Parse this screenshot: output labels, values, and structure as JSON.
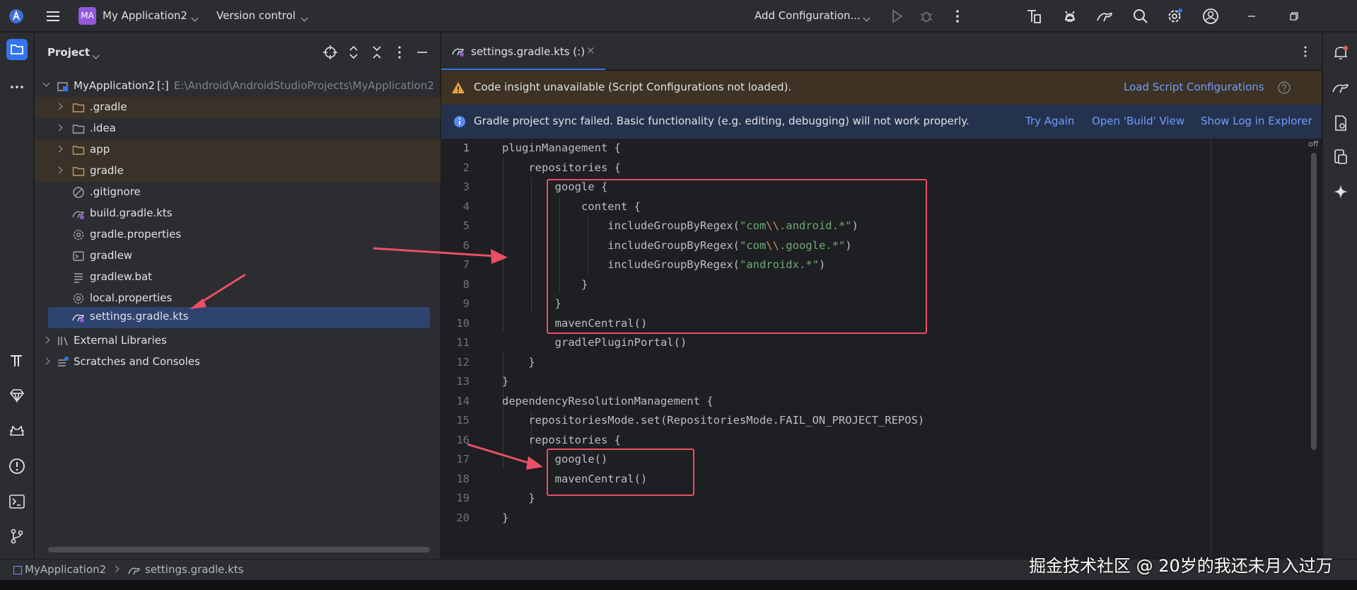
{
  "titlebar": {
    "project_badge": "MA",
    "project_name": "My Application2",
    "vcs_label": "Version control",
    "run_config": "Add Configuration..."
  },
  "project_panel": {
    "title": "Project",
    "tree": [
      {
        "label": ".gradle",
        "icon": "folder-icon"
      },
      {
        "label": ".idea",
        "icon": "folder-icon"
      },
      {
        "label": "app",
        "icon": "folder-icon"
      },
      {
        "label": "gradle",
        "icon": "folder-icon"
      },
      {
        "label": ".gitignore",
        "icon": "ignore-file-icon"
      },
      {
        "label": "build.gradle.kts",
        "icon": "gradle-file-icon"
      },
      {
        "label": "gradle.properties",
        "icon": "settings-file-icon"
      },
      {
        "label": "gradlew",
        "icon": "terminal-file-icon"
      },
      {
        "label": "gradlew.bat",
        "icon": "text-file-icon"
      },
      {
        "label": "local.properties",
        "icon": "settings-file-icon"
      },
      {
        "label": "settings.gradle.kts",
        "icon": "gradle-file-icon"
      }
    ],
    "root_label": "MyApplication2",
    "root_path": "E:\\Android\\AndroidStudioProjects\\MyApplication2",
    "root_module_tag": "[:]",
    "external_libraries": "External Libraries",
    "scratches": "Scratches and Consoles"
  },
  "editor": {
    "tab_label": "settings.gradle.kts (:)",
    "tab_close": "×",
    "warn_banner": {
      "text": "Code insight unavailable (Script Configurations not loaded).",
      "action": "Load Script Configurations"
    },
    "info_banner": {
      "text": "Gradle project sync failed. Basic functionality (e.g. editing, debugging) will not work properly.",
      "actions": [
        "Try Again",
        "Open 'Build' View",
        "Show Log in Explorer"
      ]
    },
    "inspection_label": "off",
    "lines": [
      {
        "n": "1",
        "parts": [
          {
            "t": "pluginManagement {"
          }
        ]
      },
      {
        "n": "2",
        "parts": [
          {
            "t": "    repositories {"
          }
        ]
      },
      {
        "n": "3",
        "parts": [
          {
            "t": "        google {"
          }
        ]
      },
      {
        "n": "4",
        "parts": [
          {
            "t": "            content {"
          }
        ]
      },
      {
        "n": "5",
        "parts": [
          {
            "t": "                includeGroupByRegex("
          },
          {
            "t": "\"com",
            "c": "str"
          },
          {
            "t": "\\\\",
            "c": "esc"
          },
          {
            "t": ".android.*\"",
            "c": "str"
          },
          {
            "t": ")"
          }
        ]
      },
      {
        "n": "6",
        "parts": [
          {
            "t": "                includeGroupByRegex("
          },
          {
            "t": "\"com",
            "c": "str"
          },
          {
            "t": "\\\\",
            "c": "esc"
          },
          {
            "t": ".google.*\"",
            "c": "str"
          },
          {
            "t": ")"
          }
        ]
      },
      {
        "n": "7",
        "parts": [
          {
            "t": "                includeGroupByRegex("
          },
          {
            "t": "\"androidx.*\"",
            "c": "str"
          },
          {
            "t": ")"
          }
        ]
      },
      {
        "n": "8",
        "parts": [
          {
            "t": "            }"
          }
        ]
      },
      {
        "n": "9",
        "parts": [
          {
            "t": "        }"
          }
        ]
      },
      {
        "n": "10",
        "parts": [
          {
            "t": "        mavenCentral()"
          }
        ]
      },
      {
        "n": "11",
        "parts": [
          {
            "t": "        gradlePluginPortal()"
          }
        ]
      },
      {
        "n": "12",
        "parts": [
          {
            "t": "    }"
          }
        ]
      },
      {
        "n": "13",
        "parts": [
          {
            "t": "}"
          }
        ]
      },
      {
        "n": "14",
        "parts": [
          {
            "t": "dependencyResolutionManagement {"
          }
        ]
      },
      {
        "n": "15",
        "parts": [
          {
            "t": "    repositoriesMode.set(RepositoriesMode.FAIL_ON_PROJECT_REPOS)"
          }
        ]
      },
      {
        "n": "16",
        "parts": [
          {
            "t": "    repositories {"
          }
        ]
      },
      {
        "n": "17",
        "parts": [
          {
            "t": "        google()"
          }
        ]
      },
      {
        "n": "18",
        "parts": [
          {
            "t": "        mavenCentral()"
          }
        ]
      },
      {
        "n": "19",
        "parts": [
          {
            "t": "    }"
          }
        ]
      },
      {
        "n": "20",
        "parts": [
          {
            "t": "}"
          }
        ]
      }
    ]
  },
  "statusbar": {
    "breadcrumb_project": "MyApplication2",
    "breadcrumb_file": "settings.gradle.kts"
  },
  "watermark": "掘金技术社区 @ 20岁的我还未月入过万",
  "colors": {
    "accent": "#3574f0",
    "annotation_red": "#e94f65",
    "string_green": "#6aab73",
    "link_blue": "#6f9eff"
  }
}
